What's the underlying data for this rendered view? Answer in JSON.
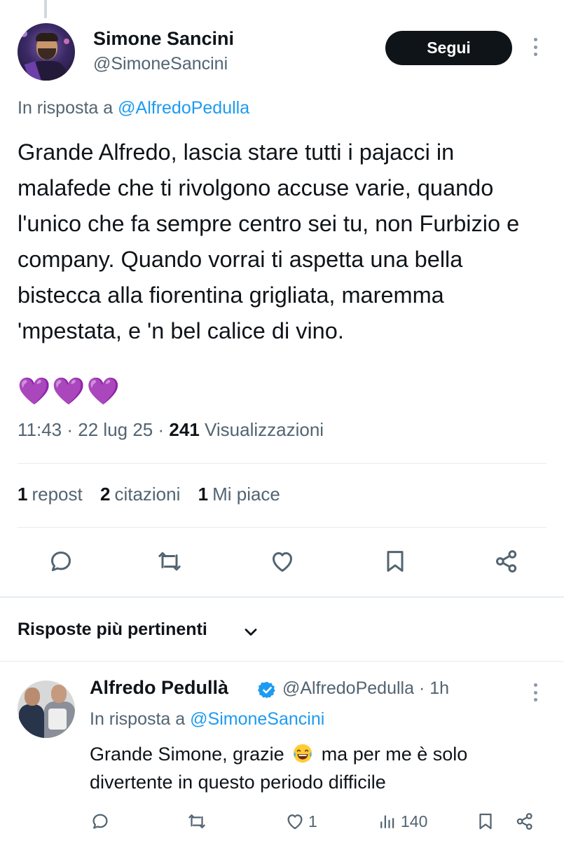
{
  "tweet": {
    "author_name": "Simone Sancini",
    "author_handle": "@SimoneSancini",
    "follow_label": "Segui",
    "reply_prefix": "In risposta a",
    "reply_handle": "@AlfredoPedulla",
    "text": "Grande Alfredo, lascia stare tutti i pajacci in malafede che ti rivolgono accuse varie, quando l'unico che fa sempre centro sei tu, non Furbizio e company. Quando vorrai ti aspetta una bella bistecca alla fiorentina grigliata, maremma 'mpestata, e 'n bel calice di vino.",
    "hearts": "💜💜💜",
    "time": "11:43",
    "separator": "·",
    "date": "22 lug 25",
    "views_count": "241",
    "views_label": "Visualizzazioni",
    "stats": {
      "reposts_count": "1",
      "reposts_label": "repost",
      "quotes_count": "2",
      "quotes_label": "citazioni",
      "likes_count": "1",
      "likes_label": "Mi piace"
    },
    "actions": [
      "reply-icon",
      "retweet-icon",
      "like-icon",
      "bookmark-icon",
      "share-icon"
    ]
  },
  "replies_section": {
    "title": "Risposte più pertinenti"
  },
  "reply": {
    "author_name": "Alfredo Pedullà",
    "author_handle": "@AlfredoPedulla",
    "separator": "·",
    "age": "1h",
    "reply_prefix": "In risposta a",
    "reply_handle": "@SimoneSancini",
    "text_before_emoji": "Grande Simone, grazie",
    "emoji": "face-with-tears-of-joy",
    "text_after_emoji": "ma per me è solo divertente in questo periodo difficile",
    "like_count": "1",
    "views_count": "140"
  },
  "colors": {
    "text": "#0f1419",
    "secondary": "#536471",
    "link": "#1d9bf0",
    "divider": "#e6ecf0",
    "button_bg": "#0f1419",
    "heart": "#8b2fc9"
  }
}
